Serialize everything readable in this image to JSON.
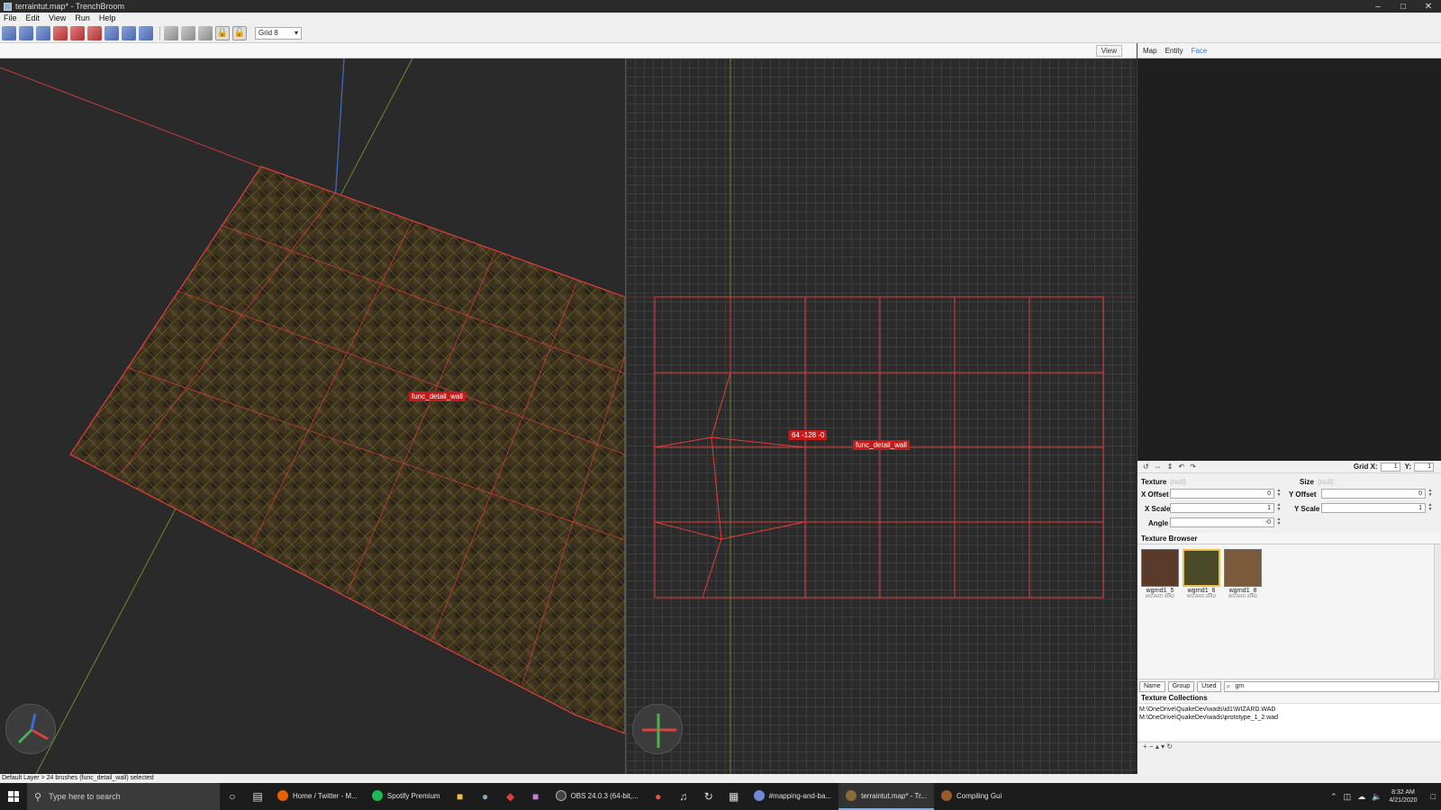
{
  "window": {
    "title": "terraintut.map* - TrenchBroom",
    "min": "–",
    "max": "□",
    "close": "✕"
  },
  "menu": [
    "File",
    "Edit",
    "View",
    "Run",
    "Help"
  ],
  "toolbar": {
    "grid_select": "Grid 8"
  },
  "views": {
    "view_button": "View",
    "label_3d": "func_detail_wall",
    "label_2d_coord": "64 -128 -0",
    "label_2d": "func_detail_wall"
  },
  "right_tabs": [
    "Map",
    "Entity",
    "Face"
  ],
  "face_editor": {
    "grid_label": "Grid X:",
    "grid_x": "1",
    "grid_y_label": "Y:",
    "grid_y": "1",
    "texture_label": "Texture",
    "texture_value": "(null)",
    "size_label": "Size",
    "size_value": "(null)",
    "x_offset_label": "X Offset",
    "x_offset": "0",
    "y_offset_label": "Y Offset",
    "y_offset": "0",
    "x_scale_label": "X Scale",
    "x_scale": "1",
    "y_scale_label": "Y Scale",
    "y_scale": "1",
    "angle_label": "Angle",
    "angle": "-0"
  },
  "texture_browser": {
    "title": "Texture Browser",
    "textures": [
      {
        "name": "wgrnd1_5",
        "wad": "WIZARD.WAD",
        "color": "#5a3a28"
      },
      {
        "name": "wgrnd1_6",
        "wad": "WIZARD.WAD",
        "color": "#4a4a26"
      },
      {
        "name": "wgrnd1_8",
        "wad": "WIZARD.WAD",
        "color": "#7a5a3a"
      }
    ],
    "sort": "Name",
    "group": "Group",
    "used": "Used",
    "filter": "grn"
  },
  "texture_collections": {
    "title": "Texture Collections",
    "items": [
      "M:\\OneDrive\\QuakeDev\\wads\\id1\\WIZARD.WAD",
      "M:\\OneDrive\\QuakeDev\\wads\\prototype_1_2.wad"
    ]
  },
  "status_bar": "Default Layer > 24 brushes (func_detail_wall) selected",
  "taskbar": {
    "search_placeholder": "Type here to search",
    "apps": [
      {
        "label": "Home / Twitter - M...",
        "color": "#e66000",
        "active": false
      },
      {
        "label": "Spotify Premium",
        "color": "#1db954",
        "active": false
      },
      {
        "label": "OBS 24.0.3 (64-bit,...",
        "color": "#444444",
        "active": false
      },
      {
        "label": "#mapping-and-ba...",
        "color": "#7289da",
        "active": false
      },
      {
        "label": "terraintut.map* - Tr...",
        "color": "#8a6a3a",
        "active": true
      },
      {
        "label": "Compiling Gui",
        "color": "#9a5a2a",
        "active": false
      }
    ],
    "time": "8:32 AM",
    "date": "4/21/2020"
  },
  "colors": {
    "accent": "#3a7bd5",
    "selection": "#c61a1a",
    "brush_edge": "#e23c3c",
    "vertex": "#f5c842"
  }
}
